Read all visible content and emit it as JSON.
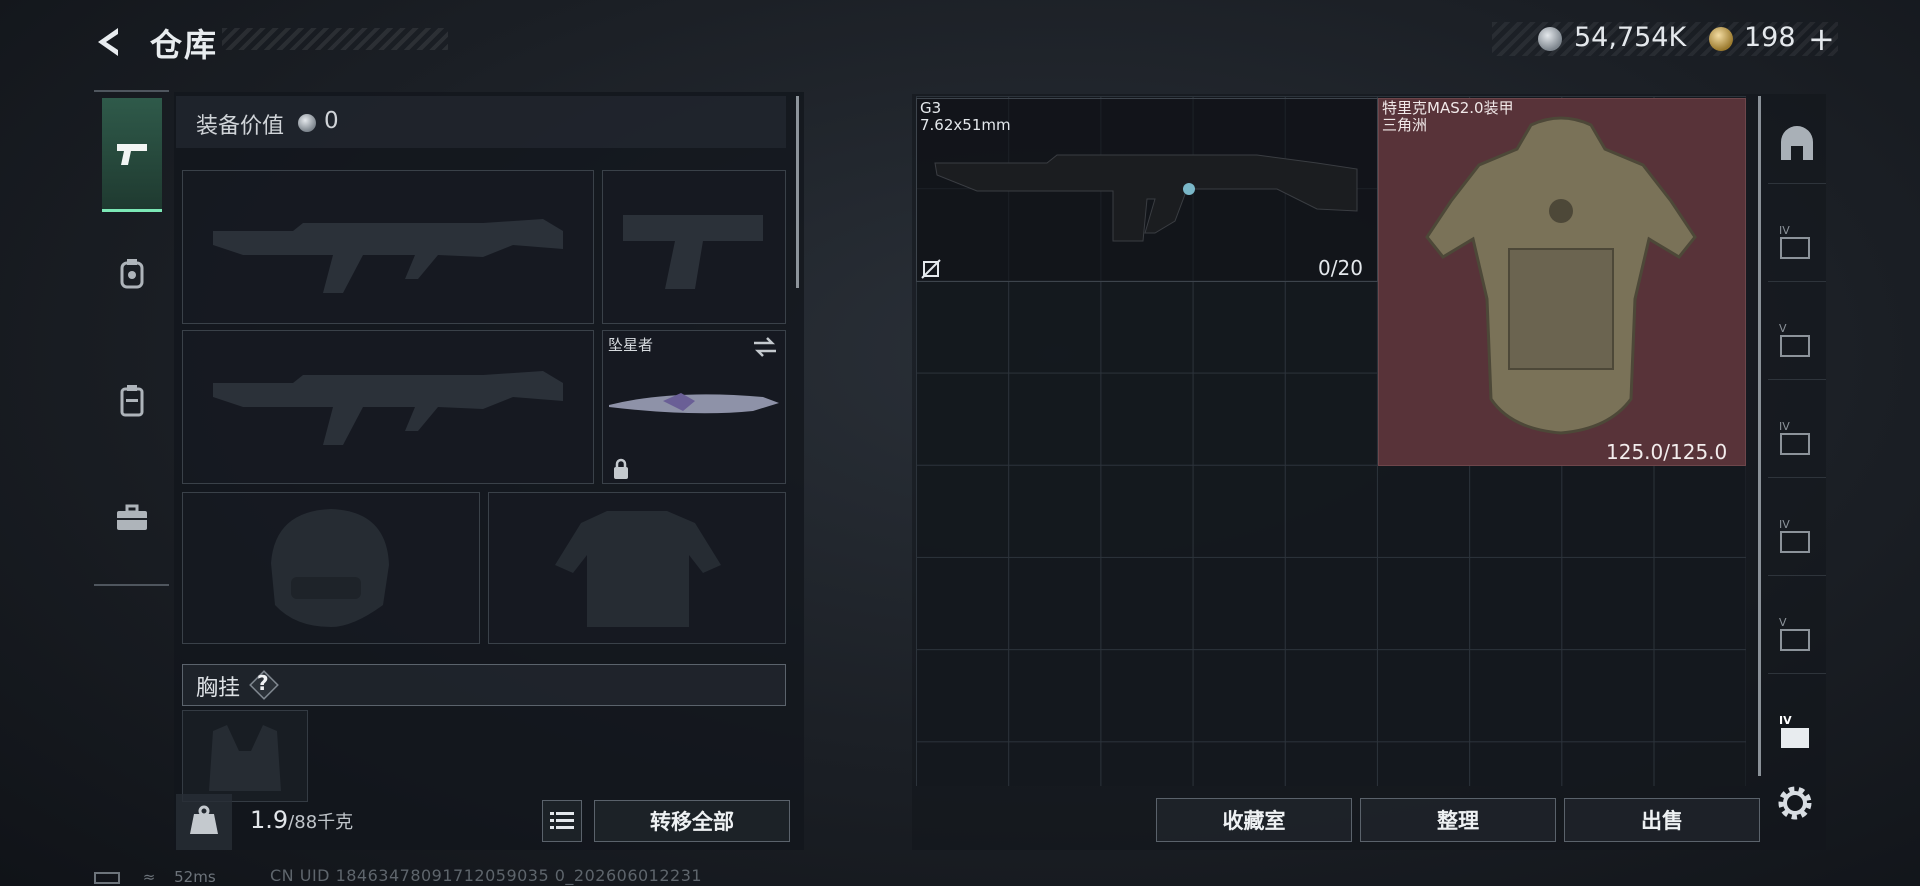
{
  "header": {
    "title": "仓库",
    "money": "54,754K",
    "tokens": "198",
    "plus": "+"
  },
  "left_panel": {
    "value_label": "装备价值",
    "value_amount": "0",
    "melee_name": "坠星者",
    "chest_label": "胸挂",
    "help_label": "?",
    "weight_current": "1.9",
    "weight_max": "/88千克",
    "transfer_all": "转移全部"
  },
  "stash": {
    "items": [
      {
        "name": "G3",
        "caliber": "7.62x51mm",
        "ammo": "0/20"
      },
      {
        "name": "特里克MAS2.0装甲",
        "map": "三角洲",
        "durability": "125.0/125.0"
      }
    ],
    "buttons": {
      "collection": "收藏室",
      "sort": "整理",
      "sell": "出售"
    }
  },
  "status": {
    "ping": "52ms",
    "uid": "CN UID 18463478091712059035 0_202606012231"
  },
  "colors": {
    "accent_green": "#7ce8b6",
    "armor_bg": "#583339"
  }
}
